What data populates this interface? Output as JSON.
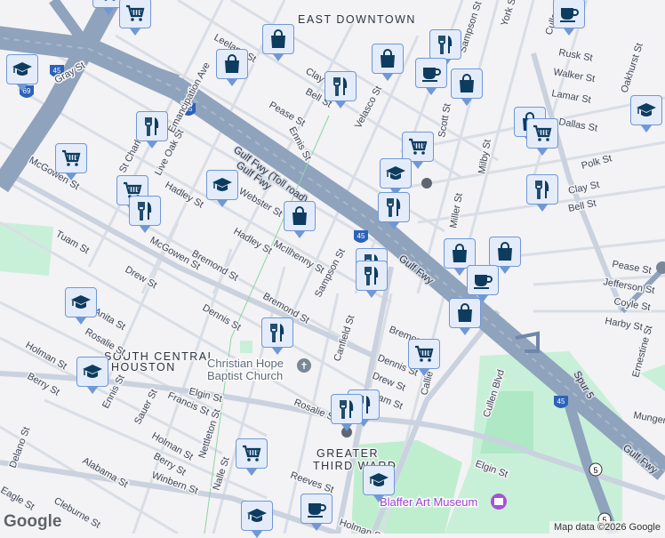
{
  "neighborhoods": [
    "EAST DOWNTOWN",
    "SOUTH CENTRAL",
    "HOUSTON",
    "GREATER",
    "THIRD WARD"
  ],
  "pois": {
    "church_line1": "Christian Hope",
    "church_line2": "Baptist Church",
    "museum": "Blaffer Art Museum"
  },
  "freeways": [
    "Gulf Fwy (Toll road)",
    "Gulf Fwy",
    "Gulf Fwy",
    "Gulf Fwy",
    "Spur 5",
    "I-45",
    "I-69"
  ],
  "shields": {
    "i45": "45",
    "i69": "69",
    "sr5": "5"
  },
  "streets": [
    "Gray St",
    "McGowen St",
    "Leeland St",
    "Clay St",
    "Bell St",
    "Pease St",
    "Ennis St",
    "Velasco St",
    "Live Oak St",
    "St Charles St",
    "Hadley St",
    "Webster St",
    "Hadley St",
    "McIlhenny St",
    "Bremond St",
    "Bremond St",
    "Dennis St",
    "Drew St",
    "Tuam St",
    "McGowen St",
    "Sampson St",
    "Anita St",
    "Rosalie St",
    "Holman St",
    "Berry St",
    "Elgin St",
    "Francis St",
    "Sauer St",
    "Ennis St",
    "Holman St",
    "Berry St",
    "Winbern St",
    "Alabama St",
    "Nettleton St",
    "Nalle St",
    "Reeves St",
    "Delano St",
    "Eagle St",
    "Cleburne St",
    "Canfield St",
    "Dennis St",
    "Drew St",
    "Tuam St",
    "Rosalie St",
    "Callie St",
    "Cullen Blvd",
    "Elgin St",
    "Holman St",
    "Scott St",
    "Miller St",
    "Milby St",
    "Polk St",
    "Clay St",
    "Bell St",
    "Pease St",
    "Jefferson St",
    "Coyle St",
    "Harby St",
    "Ernestine St",
    "Munger St",
    "Rusk St",
    "Walker St",
    "Lamar St",
    "Dallas St",
    "Oakhurst St",
    "York St",
    "Sampson St",
    "Emancipation Ave",
    "Cullen Blvd",
    "Bremond St"
  ],
  "markers": [
    "cart",
    "cart",
    "school",
    "bag",
    "bag",
    "bag",
    "restaurant",
    "restaurant",
    "coffee",
    "bag",
    "school",
    "bag",
    "cart",
    "restaurant",
    "cart",
    "cart",
    "school",
    "cart",
    "school",
    "restaurant",
    "bag",
    "restaurant",
    "restaurant",
    "bag",
    "bag",
    "restaurant",
    "restaurant",
    "coffee",
    "bag",
    "school",
    "restaurant",
    "cart",
    "school",
    "restaurant",
    "restaurant",
    "cart",
    "school",
    "coffee",
    "school",
    "coffee"
  ],
  "attribution": "Map data ©2026 Google",
  "logo": "Google",
  "colors": {
    "freeway": "#8fa3bd",
    "road": "#d5dbe3",
    "park": "#c8f0d8",
    "marker_bg": "#e4ecfa",
    "marker_icon": "#0d3c5f"
  }
}
